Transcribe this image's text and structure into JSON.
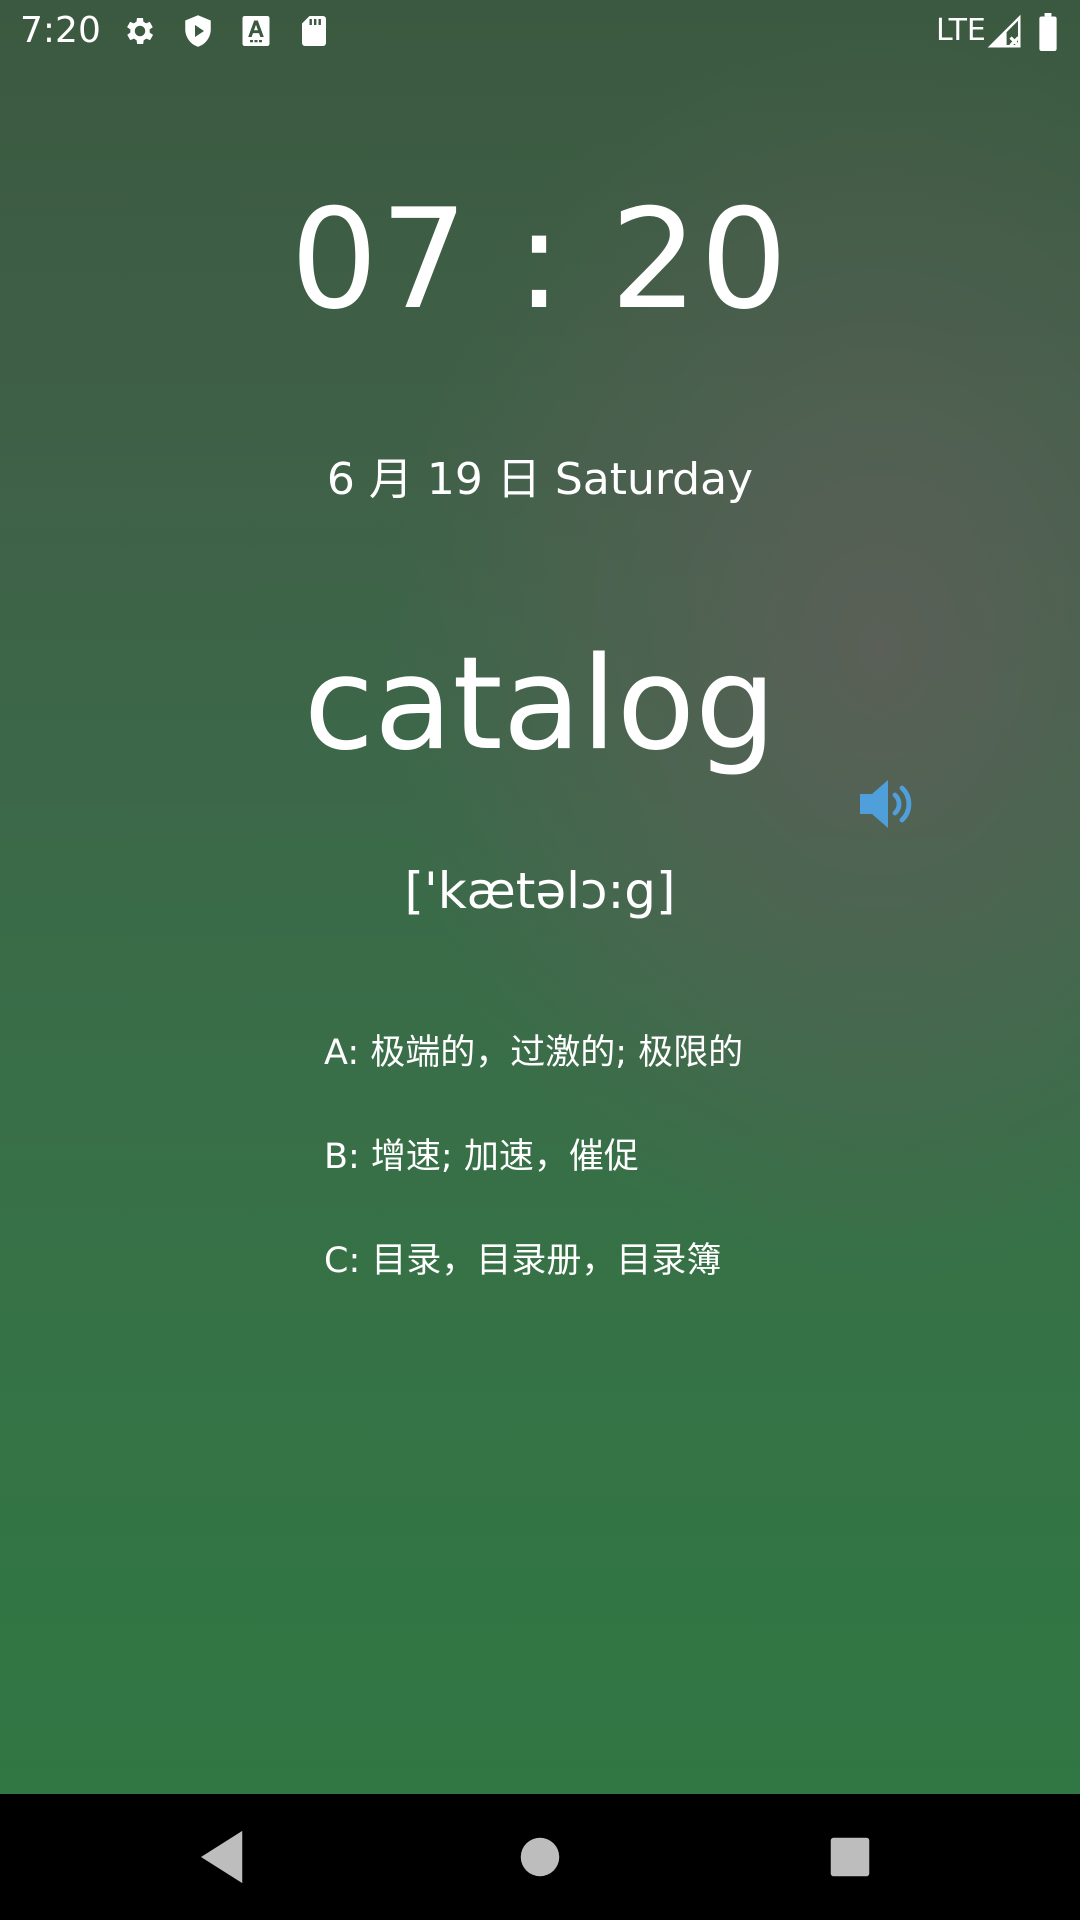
{
  "status_bar": {
    "time": "7:20",
    "network": "LTE",
    "icons": [
      "settings-icon",
      "shield-icon",
      "font-a-icon",
      "sd-card-icon",
      "signal-icon",
      "battery-icon"
    ]
  },
  "lock_screen": {
    "clock": "07 : 20",
    "date": "6 月 19 日 Saturday",
    "word": "catalog",
    "phonetic": "['kætəlɔ:g]",
    "speaker_icon": "speaker-icon",
    "options": [
      {
        "label": "A: 极端的，过激的; 极限的"
      },
      {
        "label": "B: 增速; 加速，催促"
      },
      {
        "label": "C: 目录，目录册，目录簿"
      }
    ]
  },
  "nav_bar": {
    "icons": [
      "back-icon",
      "home-icon",
      "recents-icon"
    ]
  },
  "colors": {
    "accent": "#4f9fdb",
    "text": "#ffffff",
    "nav_background": "#000000"
  }
}
